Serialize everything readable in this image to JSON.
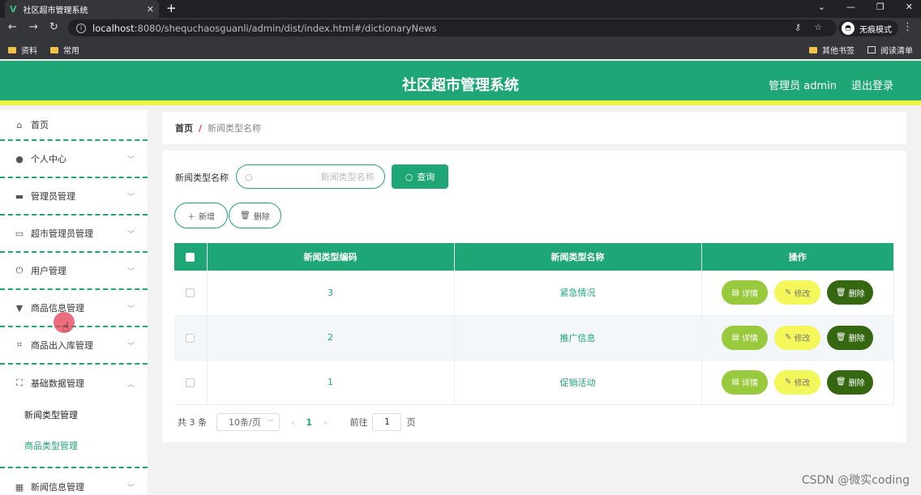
{
  "browser": {
    "tab_title": "社区超市管理系统",
    "url_host": "localhost",
    "url_rest": ":8080/shequchaosguanli/admin/dist/index.html#/dictionaryNews",
    "incognito_label": "无痕模式",
    "bookmarks": [
      "资料",
      "常用"
    ],
    "bookmarks_right": [
      "其他书签",
      "阅读清单"
    ]
  },
  "header": {
    "title": "社区超市管理系统",
    "user_label": "管理员 admin",
    "logout_label": "退出登录"
  },
  "sidebar": {
    "items": [
      {
        "label": "首页",
        "icon": "home-icon"
      },
      {
        "label": "个人中心",
        "icon": "user-icon"
      },
      {
        "label": "管理员管理",
        "icon": "monitor-icon"
      },
      {
        "label": "超市管理员管理",
        "icon": "id-card-icon"
      },
      {
        "label": "用户管理",
        "icon": "power-icon"
      },
      {
        "label": "商品信息管理",
        "icon": "pin-icon"
      },
      {
        "label": "商品出入库管理",
        "icon": "crop-icon"
      },
      {
        "label": "基础数据管理",
        "icon": "fullscreen-icon"
      },
      {
        "label": "新闻信息管理",
        "icon": "grid-icon"
      }
    ],
    "submenu": [
      "新闻类型管理",
      "商品类型管理"
    ]
  },
  "breadcrumb": {
    "home": "首页",
    "separator": "/",
    "current": "新闻类型名称"
  },
  "search": {
    "label": "新闻类型名称",
    "placeholder": "新闻类型名称",
    "button": "查询"
  },
  "actions": {
    "add": "新增",
    "delete": "删除"
  },
  "table": {
    "headers": [
      "新闻类型编码",
      "新闻类型名称",
      "操作"
    ],
    "rows": [
      {
        "code": "3",
        "name": "紧急情况"
      },
      {
        "code": "2",
        "name": "推广信息"
      },
      {
        "code": "1",
        "name": "促销活动"
      }
    ],
    "op_labels": {
      "detail": "详情",
      "edit": "修改",
      "delete": "删除"
    }
  },
  "pagination": {
    "total": "共 3 条",
    "page_size": "10条/页",
    "current_page": "1",
    "goto_label": "前往",
    "goto_value": "1",
    "page_suffix": "页"
  },
  "watermark": "CSDN @微实coding",
  "colors": {
    "primary": "#1ea676",
    "accent_strip": "#ecf542",
    "detail": "#99c93c",
    "edit": "#f4f75a",
    "delete": "#356710"
  }
}
